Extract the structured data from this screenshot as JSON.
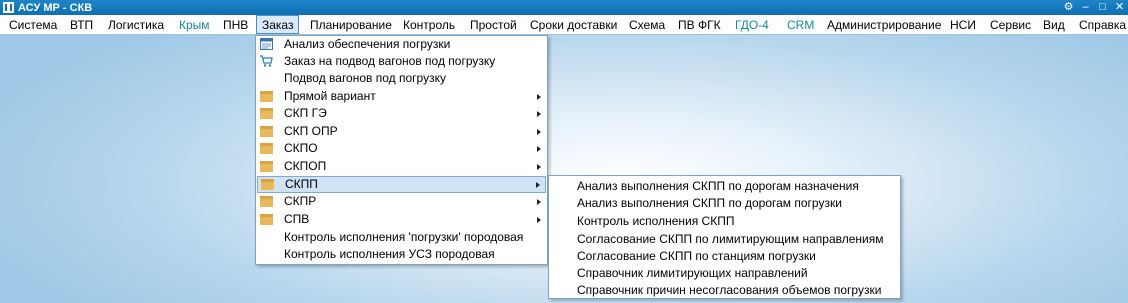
{
  "window": {
    "title": "АСУ МР - СКВ",
    "controls": [
      "settings-icon",
      "minimize-icon",
      "maximize-icon",
      "close-icon"
    ]
  },
  "menubar": {
    "items": [
      {
        "label": "Система"
      },
      {
        "label": "ВТП"
      },
      {
        "label": "Логистика"
      },
      {
        "label": "Крым"
      },
      {
        "label": "ПНВ"
      },
      {
        "label": "Заказ"
      },
      {
        "label": "Планирование"
      },
      {
        "label": "Контроль"
      },
      {
        "label": "Простой"
      },
      {
        "label": "Сроки доставки"
      },
      {
        "label": "Схема"
      },
      {
        "label": "ПВ ФГК"
      },
      {
        "label": "ГДО-4"
      },
      {
        "label": "CRM"
      },
      {
        "label": "Администрирование"
      },
      {
        "label": "НСИ"
      },
      {
        "label": "Сервис"
      },
      {
        "label": "Вид"
      },
      {
        "label": "Справка"
      }
    ],
    "active": "Заказ"
  },
  "zakaz_menu": {
    "items": [
      {
        "label": "Анализ обеспечения погрузки",
        "icon": "report-icon"
      },
      {
        "label": "Заказ на подвод вагонов под погрузку",
        "icon": "cart-icon"
      },
      {
        "label": "Подвод вагонов под погрузку",
        "icon": ""
      },
      {
        "label": "Прямой вариант",
        "icon": "folder-icon",
        "submenu": true
      },
      {
        "label": "СКП ГЭ",
        "icon": "folder-icon",
        "submenu": true
      },
      {
        "label": "СКП ОПР",
        "icon": "folder-icon",
        "submenu": true
      },
      {
        "label": "СКПО",
        "icon": "folder-icon",
        "submenu": true
      },
      {
        "label": "СКПОП",
        "icon": "folder-icon",
        "submenu": true
      },
      {
        "label": "СКПП",
        "icon": "folder-icon",
        "submenu": true
      },
      {
        "label": "СКПР",
        "icon": "folder-icon",
        "submenu": true
      },
      {
        "label": "СПВ",
        "icon": "folder-icon",
        "submenu": true
      },
      {
        "label": "Контроль исполнения 'погрузки' породовая",
        "icon": ""
      },
      {
        "label": "Контроль исполнения УСЗ породовая",
        "icon": ""
      }
    ],
    "highlighted": "СКПП"
  },
  "skpp_submenu": {
    "items": [
      {
        "label": "Анализ выполнения СКПП по дорогам назначения"
      },
      {
        "label": "Анализ выполнения СКПП по дорогам погрузки"
      },
      {
        "label": "Контроль исполнения СКПП"
      },
      {
        "label": "Согласование СКПП по лимитирующим направлениям"
      },
      {
        "label": "Согласование СКПП по станциям погрузки"
      },
      {
        "label": "Справочник лимитирующих направлений"
      },
      {
        "label": "Справочник причин несогласования объемов погрузки"
      }
    ]
  },
  "colors": {
    "titlebar": "#0f6fb3",
    "highlight": "#cfe3f5",
    "teal_menu_text": "#1687a5"
  }
}
